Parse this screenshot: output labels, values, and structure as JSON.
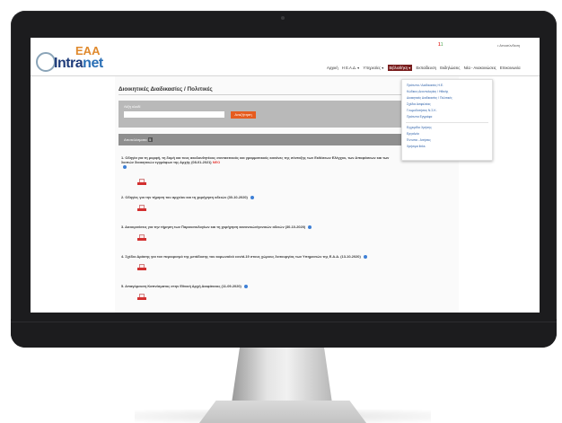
{
  "logo": {
    "mark_a": "EA",
    "mark_b": "A",
    "text_a": "Intra",
    "text_b": "net"
  },
  "header": {
    "notifications": {
      "red": "1",
      "green": "1"
    },
    "logout": "• Αποσύνδεση"
  },
  "nav": {
    "items": [
      {
        "label": "Αρχική"
      },
      {
        "label": "Η Ε.Α.Δ. ▾"
      },
      {
        "label": "Υπηρεσίες ▾"
      },
      {
        "label": "Βιβλιοθήκη ▾"
      },
      {
        "label": "Εκπαίδευση"
      },
      {
        "label": "Εκδηλώσεις"
      },
      {
        "label": "Νέα - Ανακοινώσεις"
      },
      {
        "label": "Επικοινωνία"
      }
    ],
    "active": "Βιβλιοθήκη ▾"
  },
  "dropdown": {
    "items": [
      "Πρότυπα / Διαδικασίες Η.Ε.",
      "Κώδικες Δεοντολογίας / Ηθικής",
      "Διοικητικές Διαδικασίες / Πολιτικές",
      "Σχέδια Ασφαλείας",
      "Γνωμοδοτήσεις Ν.Σ.Κ.",
      "Πρότυπα Εγγράφα"
    ],
    "items2": [
      "Εγχειρίδιο Χρήσης",
      "Εργαλεία",
      "Έντυπα - Αιτήσεις",
      "Χρήσιμα links"
    ]
  },
  "page": {
    "title": "Διοικητικές Διαδικασίες / Πολιτικές",
    "search": {
      "label": "Λέξη κλειδί",
      "value": "",
      "button": "Αναζήτηση"
    },
    "results_label": "Αποτελέσματα",
    "results_count": "5"
  },
  "results": [
    {
      "title": "1. Οδηγία για τη μορφή, τη δομή και τους ακολουθητέους συντακτικούς και γραμματικούς κανόνες της σύνταξης των Εκθέσεων Ελέγχου, των Αποφάσεων και των λοιπών διοικητικών εγγράφων της Αρχής (08-01-2021)",
      "badge": "NEO"
    },
    {
      "title": "2. Οδηγίες για την τήρηση του αρχείου και τη χορήγηση αδειών (30-10-2020)",
      "badge": ""
    },
    {
      "title": "3. Διευκρινίσεις για την τήρηση των Παρουσιολογίων και τη χορήγηση κανονικών/γονικών αδειών (30-10-2020)",
      "badge": ""
    },
    {
      "title": "4. Σχέδιο Δράσης για τον περιορισμό της μετάδοσης του κορωνοϊού covid-19 στους χώρους λειτουργίας των Υπηρεσιών της Ε.Α.Δ. (13-10-2020)",
      "badge": ""
    },
    {
      "title": "5. Απαγόρευση Καπνίσματος στην Εθνική Αρχή Διαφάνειας (11-09-2020)",
      "badge": ""
    }
  ],
  "colors": {
    "accent": "#e65c1f",
    "nav_active": "#7a1e1e",
    "link": "#2b5fa8"
  }
}
